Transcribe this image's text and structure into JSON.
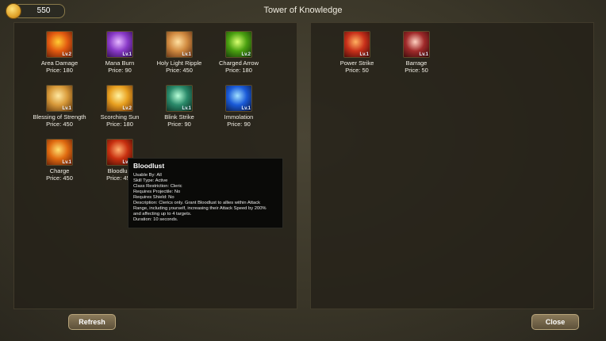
{
  "header": {
    "title": "Tower of Knowledge",
    "gold": "550"
  },
  "shop_skills": [
    {
      "name": "Area Damage",
      "price": "Price: 180",
      "lv": "Lv.2",
      "colors": [
        "#ffcc33",
        "#e25a10",
        "#5a1a08"
      ]
    },
    {
      "name": "Mana Burn",
      "price": "Price: 90",
      "lv": "Lv.1",
      "colors": [
        "#e6b8ff",
        "#8a3ac8",
        "#2a0a4a"
      ]
    },
    {
      "name": "Holy Light Ripple",
      "price": "Price: 450",
      "lv": "Lv.1",
      "colors": [
        "#ffe0a0",
        "#d08a40",
        "#5a2a10"
      ]
    },
    {
      "name": "Charged Arrow",
      "price": "Price: 180",
      "lv": "Lv.2",
      "colors": [
        "#d8ff70",
        "#4aa010",
        "#12300a"
      ]
    },
    {
      "name": "Blessing of Strength",
      "price": "Price: 450",
      "lv": "Lv.1",
      "colors": [
        "#ffe8a0",
        "#d89a3a",
        "#5a300a"
      ]
    },
    {
      "name": "Scorching Sun",
      "price": "Price: 180",
      "lv": "Lv.2",
      "colors": [
        "#fff2a0",
        "#e8a020",
        "#6a3008"
      ]
    },
    {
      "name": "Blink Strike",
      "price": "Price: 90",
      "lv": "Lv.1",
      "colors": [
        "#b8ffd8",
        "#2a8a6a",
        "#0a2a20"
      ]
    },
    {
      "name": "Immolation",
      "price": "Price: 90",
      "lv": "Lv.1",
      "colors": [
        "#a0e0ff",
        "#1a5ad8",
        "#08143a"
      ]
    },
    {
      "name": "Charge",
      "price": "Price: 450",
      "lv": "Lv.1",
      "colors": [
        "#ffe070",
        "#e06a10",
        "#5a1a08"
      ]
    },
    {
      "name": "Bloodlust",
      "price": "Price: 450",
      "lv": "Lv.1",
      "colors": [
        "#ffb070",
        "#c83010",
        "#3a0a04"
      ]
    }
  ],
  "owned_skills": [
    {
      "name": "Power Strike",
      "price": "Price: 50",
      "lv": "Lv.1",
      "colors": [
        "#ffb060",
        "#c8301a",
        "#3a0808"
      ]
    },
    {
      "name": "Barrage",
      "price": "Price: 50",
      "lv": "Lv.1",
      "colors": [
        "#ffd0c0",
        "#a02a2a",
        "#300808"
      ]
    }
  ],
  "tooltip": {
    "title": "Bloodlust",
    "lines": [
      "Usable By: All",
      "Skill Type: Active",
      "Class Restriction: Cleric",
      "Requires Projectile: No",
      "Requires Shield: No",
      "Description: Clerics only. Grant Bloodlust to allies within Attack",
      "Range, including yourself, increasing their Attack Speed by 200%",
      "and affecting up to 4 targets.",
      "Duration: 10 seconds."
    ]
  },
  "buttons": {
    "refresh": "Refresh",
    "close": "Close"
  },
  "colors": {
    "panel_bg": "#24211a",
    "button": "#7a6a4a",
    "gold_coin": "#e0a22a"
  }
}
